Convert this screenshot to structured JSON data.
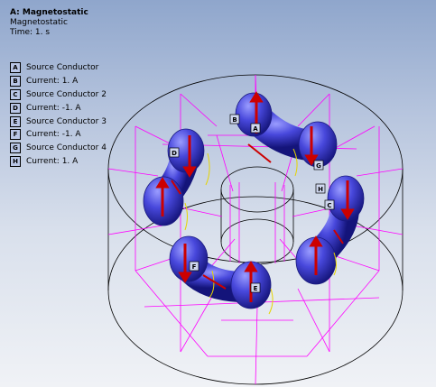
{
  "header": {
    "title": "A: Magnetostatic",
    "subtitle": "Magnetostatic",
    "time": "Time: 1. s"
  },
  "legend": [
    {
      "letter": "A",
      "label": "Source Conductor"
    },
    {
      "letter": "B",
      "label": "Current: 1. A"
    },
    {
      "letter": "C",
      "label": "Source Conductor 2"
    },
    {
      "letter": "D",
      "label": "Current: -1. A"
    },
    {
      "letter": "E",
      "label": "Source Conductor 3"
    },
    {
      "letter": "F",
      "label": "Current: -1. A"
    },
    {
      "letter": "G",
      "label": "Source Conductor 4"
    },
    {
      "letter": "H",
      "label": "Current: 1. A"
    }
  ],
  "markers": [
    "A",
    "B",
    "C",
    "D",
    "E",
    "F",
    "G",
    "H"
  ],
  "colors": {
    "mesh": "#ff00ff",
    "conductor": "#3f3fd8",
    "arrow": "#cc0000",
    "outline": "#000000"
  }
}
